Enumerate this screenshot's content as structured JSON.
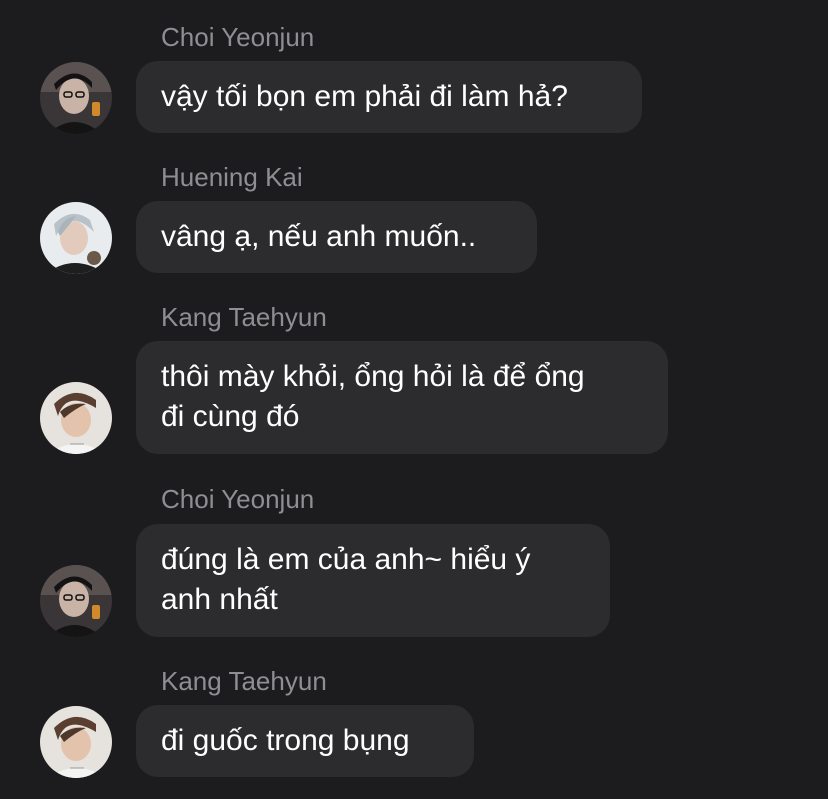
{
  "messages": [
    {
      "sender": "Choi Yeonjun",
      "avatar": "yeonjun-avatar",
      "text": "vậy tối bọn em phải đi làm hả?"
    },
    {
      "sender": "Huening Kai",
      "avatar": "kai-avatar",
      "text": "vâng ạ, nếu anh muốn.."
    },
    {
      "sender": "Kang Taehyun",
      "avatar": "taehyun-avatar",
      "text": "thôi mày khỏi, ổng hỏi là để ổng\nđi cùng đó"
    },
    {
      "sender": "Choi Yeonjun",
      "avatar": "yeonjun-avatar",
      "text": "đúng là em của anh~ hiểu ý\nanh nhất"
    },
    {
      "sender": "Kang Taehyun",
      "avatar": "taehyun-avatar",
      "text": "đi guốc trong bụng"
    }
  ],
  "colors": {
    "background": "#1c1c1e",
    "bubble": "#2c2c2e",
    "sender": "#8e8e93",
    "text": "#ffffff"
  }
}
